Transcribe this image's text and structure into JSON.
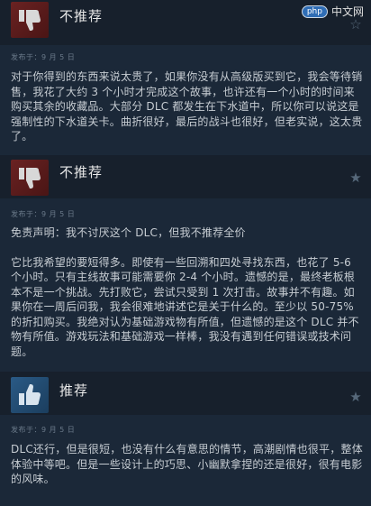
{
  "watermark": {
    "badge": "php",
    "site": "中文网"
  },
  "reviews": [
    {
      "verdict": "不推荐",
      "thumb_icon": "thumbs-down-icon",
      "date": "发布于：9 月 5 日",
      "paragraphs": [
        "对于你得到的东西来说太贵了，如果你没有从高级版买到它，我会等待销售，我花了大约 3 个小时才完成这个故事，也许还有一个小时的时间来购买其余的收藏品。大部分 DLC 都发生在下水道中，所以你可以说这是强制性的下水道关卡。曲折很好，最后的战斗也很好，但老实说，这太贵了。"
      ]
    },
    {
      "verdict": "不推荐",
      "thumb_icon": "thumbs-down-icon",
      "date": "发布于：9 月 5 日",
      "paragraphs": [
        "免责声明：我不讨厌这个 DLC，但我不推荐全价",
        "它比我希望的要短得多。即使有一些回溯和四处寻找东西，也花了 5-6 个小时。只有主线故事可能需要你 2-4 个小时。遗憾的是，最终老板根本不是一个挑战。先打败它，尝试只受到 1 次打击。故事并不有趣。如果你在一周后问我，我会很难地讲述它是关于什么的。至少以 50-75% 的折扣购买。我绝对认为基础游戏物有所值，但遗憾的是这个 DLC 并不物有所值。游戏玩法和基础游戏一样棒，我没有遇到任何错误或技术问题。"
      ]
    },
    {
      "verdict": "推荐",
      "thumb_icon": "thumbs-up-icon",
      "date": "发布于：9 月 5 日",
      "paragraphs": [
        "DLC还行，但是很短，也没有什么有意思的情节，高潮剧情也很平，整体体验中等吧。但是一些设计上的巧思、小幽默拿捏的还是很好，很有电影的风味。"
      ]
    }
  ]
}
